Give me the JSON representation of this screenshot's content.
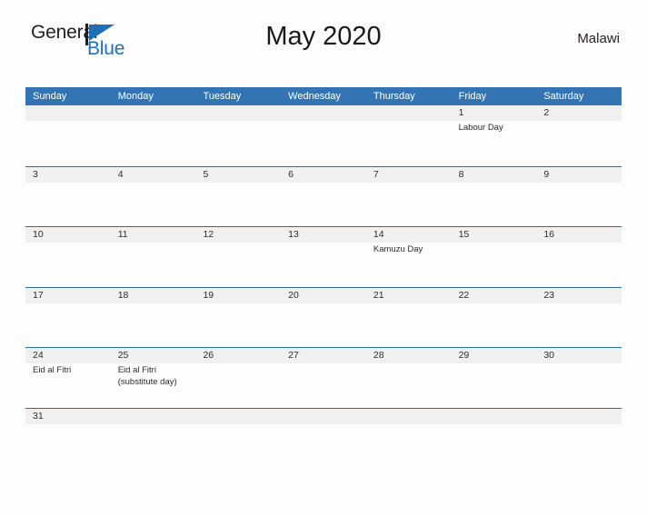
{
  "logo": {
    "word_one": "General",
    "word_two": "Blue",
    "accent_color": "#1f6fb5",
    "triangle_icon": "triangle-icon"
  },
  "header": {
    "title": "May 2020",
    "country": "Malawi"
  },
  "calendar": {
    "header_color": "#3274b4",
    "rule_color": "#2e6da4",
    "number_band_color": "#f0f0f0",
    "weekdays": [
      "Sunday",
      "Monday",
      "Tuesday",
      "Wednesday",
      "Thursday",
      "Friday",
      "Saturday"
    ],
    "weeks": [
      {
        "days": [
          {
            "number": "",
            "event": ""
          },
          {
            "number": "",
            "event": ""
          },
          {
            "number": "",
            "event": ""
          },
          {
            "number": "",
            "event": ""
          },
          {
            "number": "",
            "event": ""
          },
          {
            "number": "1",
            "event": "Labour Day"
          },
          {
            "number": "2",
            "event": ""
          }
        ]
      },
      {
        "days": [
          {
            "number": "3",
            "event": ""
          },
          {
            "number": "4",
            "event": ""
          },
          {
            "number": "5",
            "event": ""
          },
          {
            "number": "6",
            "event": ""
          },
          {
            "number": "7",
            "event": ""
          },
          {
            "number": "8",
            "event": ""
          },
          {
            "number": "9",
            "event": ""
          }
        ]
      },
      {
        "days": [
          {
            "number": "10",
            "event": ""
          },
          {
            "number": "11",
            "event": ""
          },
          {
            "number": "12",
            "event": ""
          },
          {
            "number": "13",
            "event": ""
          },
          {
            "number": "14",
            "event": "Kamuzu Day"
          },
          {
            "number": "15",
            "event": ""
          },
          {
            "number": "16",
            "event": ""
          }
        ]
      },
      {
        "days": [
          {
            "number": "17",
            "event": ""
          },
          {
            "number": "18",
            "event": ""
          },
          {
            "number": "19",
            "event": ""
          },
          {
            "number": "20",
            "event": ""
          },
          {
            "number": "21",
            "event": ""
          },
          {
            "number": "22",
            "event": ""
          },
          {
            "number": "23",
            "event": ""
          }
        ]
      },
      {
        "days": [
          {
            "number": "24",
            "event": "Eid al Fitri"
          },
          {
            "number": "25",
            "event": "Eid al Fitri\n(substitute day)"
          },
          {
            "number": "26",
            "event": ""
          },
          {
            "number": "27",
            "event": ""
          },
          {
            "number": "28",
            "event": ""
          },
          {
            "number": "29",
            "event": ""
          },
          {
            "number": "30",
            "event": ""
          }
        ]
      },
      {
        "days": [
          {
            "number": "31",
            "event": ""
          },
          {
            "number": "",
            "event": ""
          },
          {
            "number": "",
            "event": ""
          },
          {
            "number": "",
            "event": ""
          },
          {
            "number": "",
            "event": ""
          },
          {
            "number": "",
            "event": ""
          },
          {
            "number": "",
            "event": ""
          }
        ]
      }
    ]
  }
}
